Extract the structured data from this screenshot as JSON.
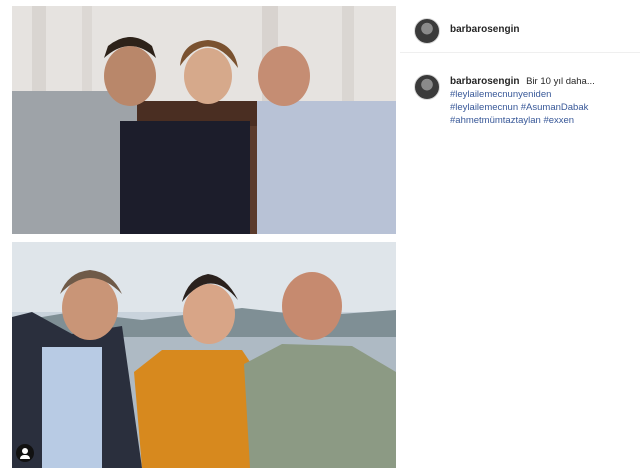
{
  "post": {
    "username": "barbarosengin",
    "caption_username": "barbarosengin",
    "caption": "Bir 10 yıl daha...",
    "hashtags": [
      "#leylailemecnunyeniden",
      "#leylailemecnun #AsumanDabak",
      "#ahmetmümtaztaylan #exxen"
    ]
  },
  "icons": {
    "avatar": "profile-avatar-icon",
    "user_tag": "user-tag-icon"
  },
  "colors": {
    "hashtag": "#385898",
    "text": "#262626",
    "divider": "#efefef"
  }
}
